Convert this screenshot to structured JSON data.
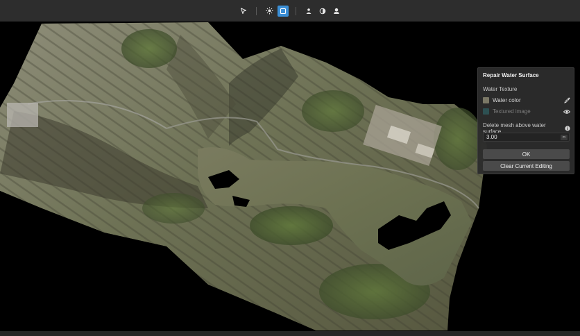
{
  "toolbar": {
    "tools": [
      {
        "icon": "cursor-arrow-icon",
        "active": false
      },
      {
        "icon": "sun-light-icon",
        "active": false
      },
      {
        "icon": "square-display-icon",
        "active": true
      },
      {
        "icon": "person-mesh-icon",
        "active": false
      },
      {
        "icon": "half-circle-shading-icon",
        "active": false
      },
      {
        "icon": "water-stamp-icon",
        "active": false
      }
    ],
    "accent": "#3b8fd6"
  },
  "panel": {
    "title": "Repair Water Surface",
    "section_label": "Water Texture",
    "water_color": {
      "label": "Water color",
      "swatch": "#7b7866",
      "icon": "eyedropper-icon"
    },
    "textured_image": {
      "label": "Textured image",
      "swatch": "#2d5052",
      "icon": "eye-icon"
    },
    "delete_label": "Delete mesh above water surface",
    "height_value": "3.00",
    "height_unit": "m",
    "ok_label": "OK",
    "clear_label": "Clear Current Editing"
  }
}
